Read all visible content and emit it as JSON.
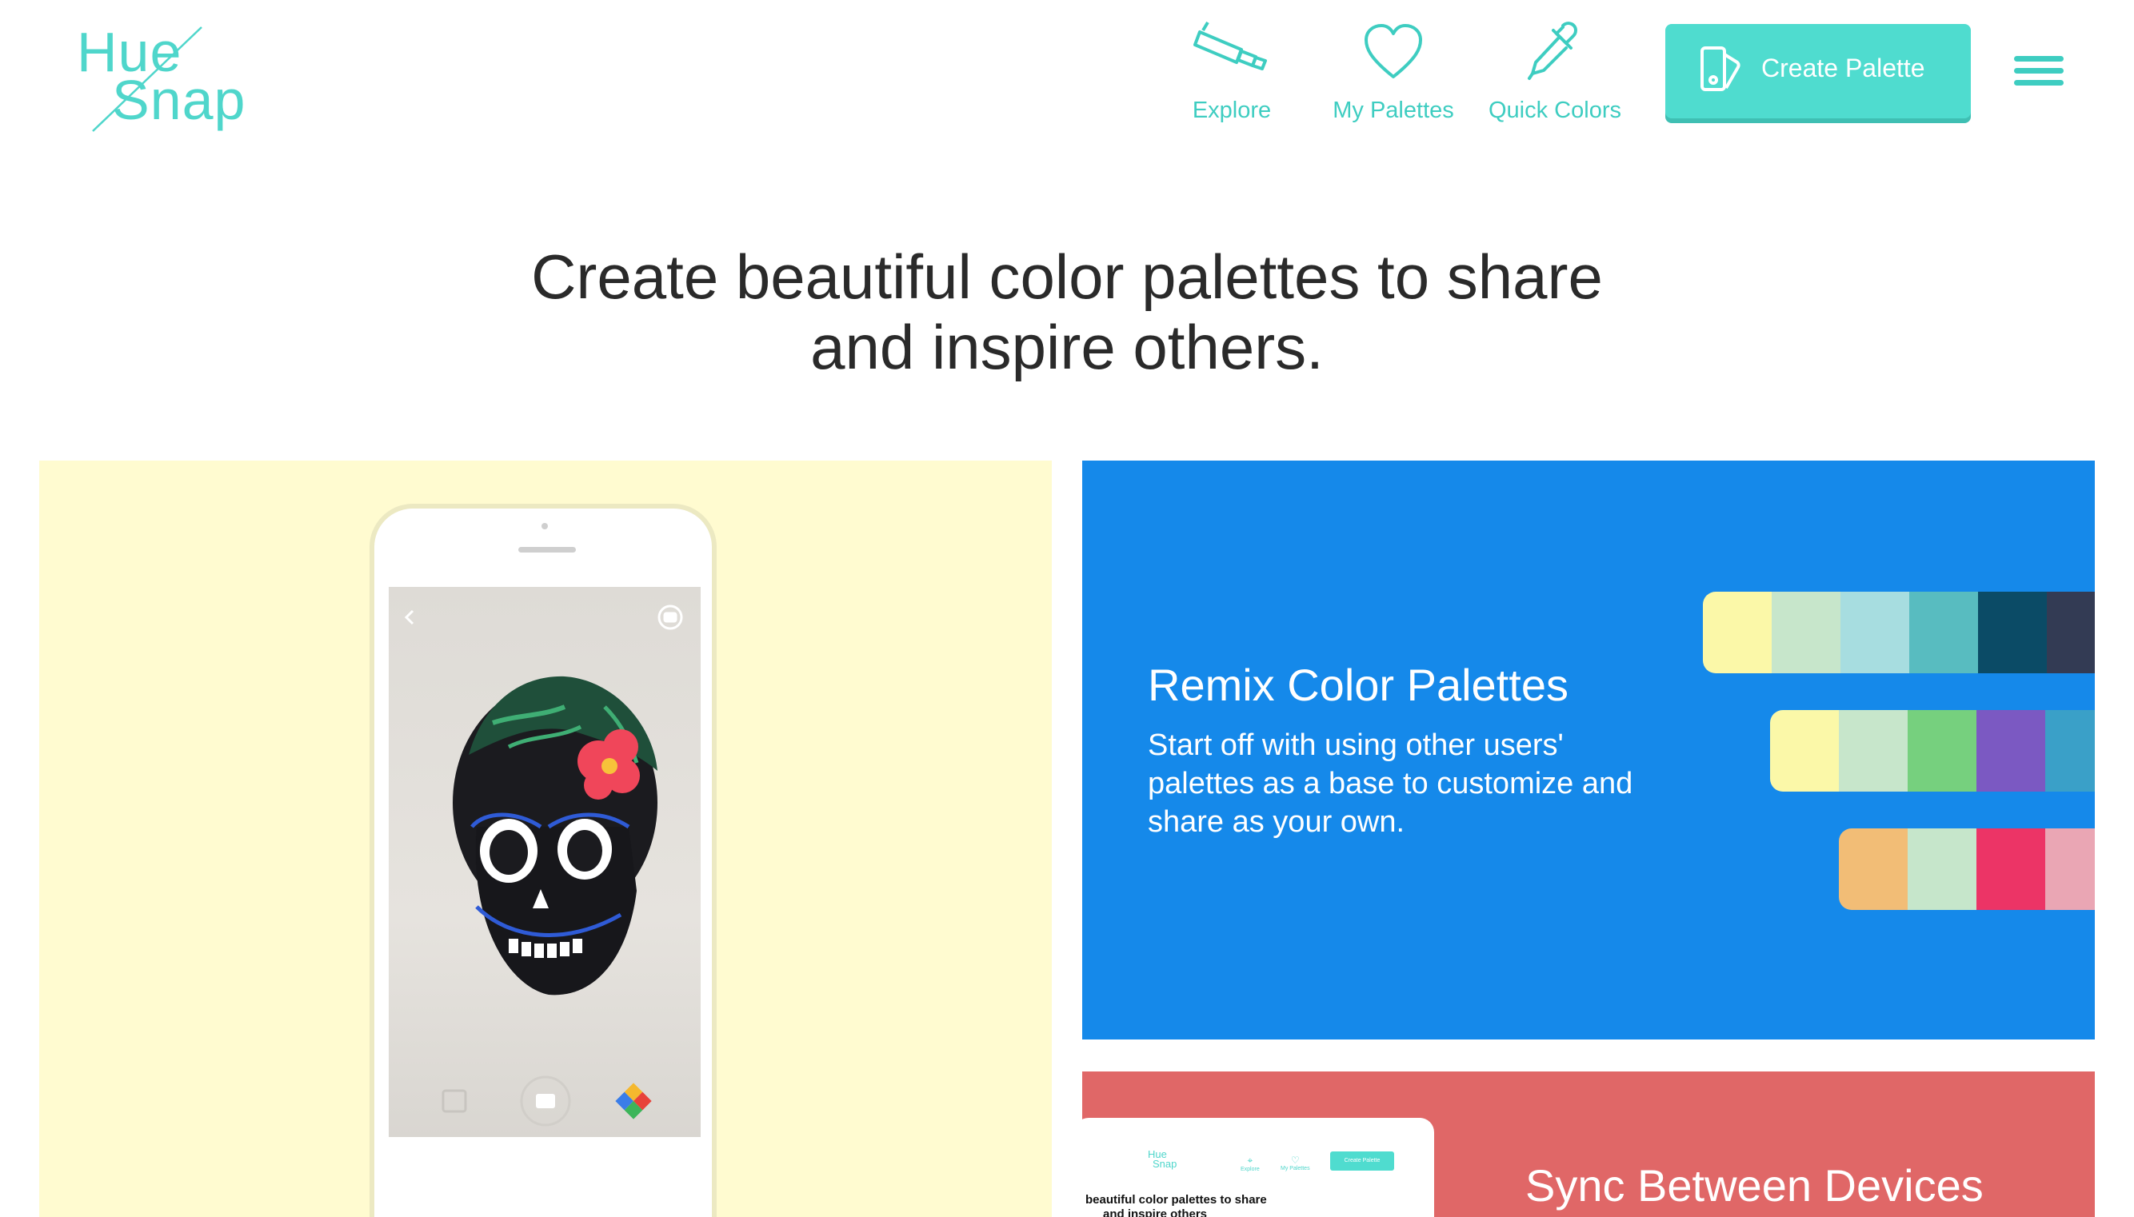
{
  "header": {
    "logo_line1": "Hue",
    "logo_line2": "Snap",
    "nav": [
      {
        "label": "Explore",
        "icon": "telescope-icon"
      },
      {
        "label": "My Palettes",
        "icon": "heart-icon"
      },
      {
        "label": "Quick Colors",
        "icon": "eyedropper-icon"
      }
    ],
    "create_button": {
      "label": "Create Palette",
      "icon": "palette-swatch-icon"
    },
    "menu_icon": "hamburger-menu-icon"
  },
  "hero": {
    "line1": "Create beautiful color palettes to share",
    "line2": "and inspire others."
  },
  "remix": {
    "title": "Remix Color Palettes",
    "text": "Start off with using other users' palettes as a base to customize and share as your own.",
    "background": "#1589ea",
    "palettes": [
      [
        "#fbf8a8",
        "#c7e6cb",
        "#a7dde0",
        "#58bcc0",
        "#0b4b66",
        "#333b54"
      ],
      [
        "#fbf8a8",
        "#c7e6cb",
        "#76d07e",
        "#7b59c2",
        "#3aa0c8"
      ],
      [
        "#f2bd76",
        "#c6e6cb",
        "#ec3466",
        "#eaa6b4"
      ]
    ]
  },
  "sync": {
    "title": "Sync Between Devices",
    "background": "#e06767",
    "preview_logo_line1": "Hue",
    "preview_logo_line2": "Snap",
    "preview_nav": [
      "Explore",
      "My Palettes"
    ],
    "preview_button": "Create Palette",
    "preview_text_line1": "beautiful color palettes to share",
    "preview_text_line2": "and inspire others"
  },
  "colors": {
    "accent": "#4fdccf",
    "accent_text": "#3ecdc1",
    "yellow_panel": "#fffbd0"
  }
}
